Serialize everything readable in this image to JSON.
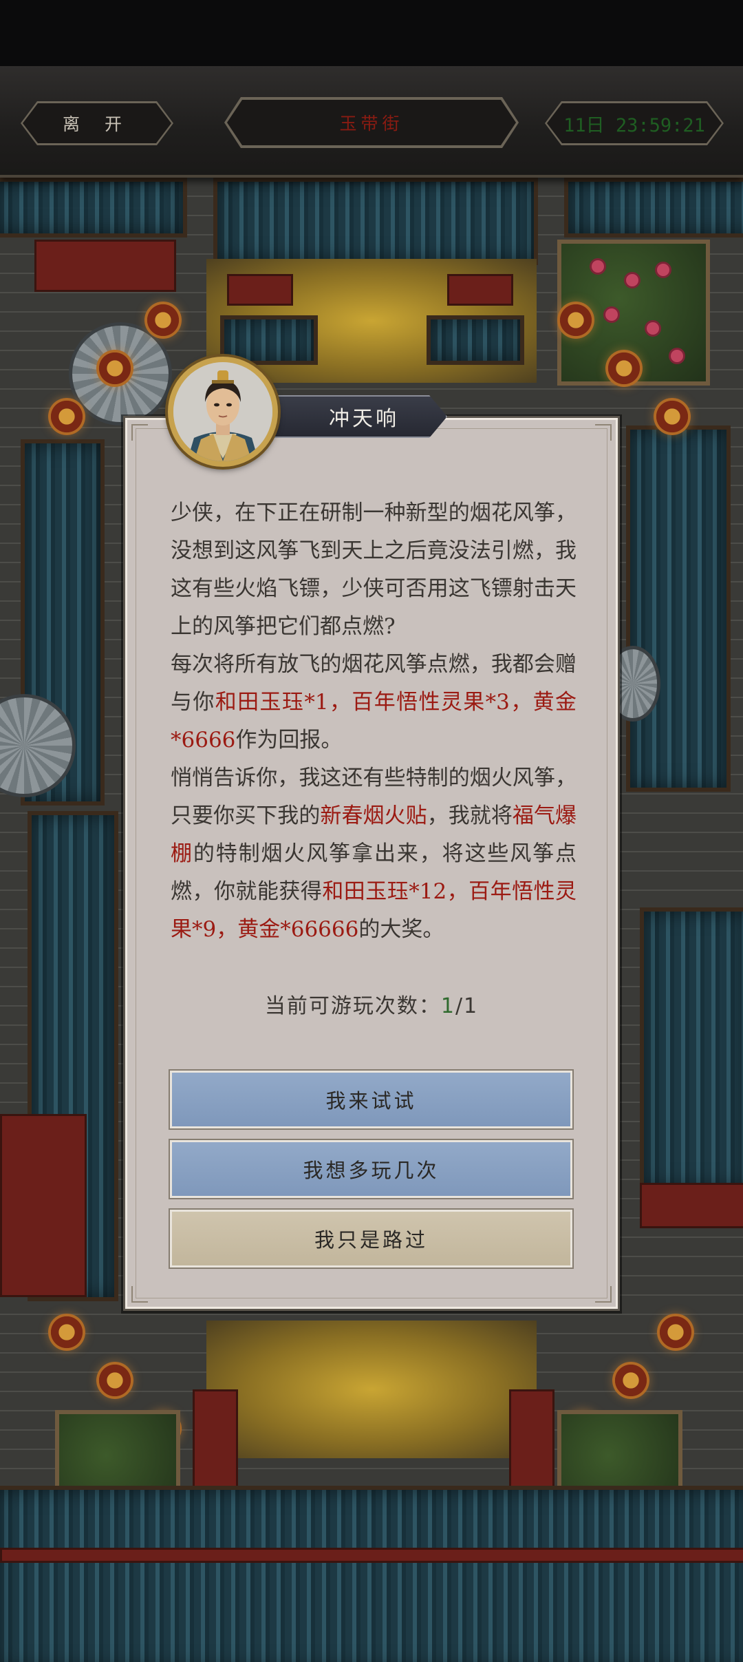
{
  "header": {
    "leave_label": "离 开",
    "street_title": "玉带街",
    "timer": "11日 23:59:21"
  },
  "dialog": {
    "npc_name": "冲天响",
    "avatar": "npc-portrait",
    "story": {
      "p1": "少侠，在下正在研制一种新型的烟花风筝，没想到这风筝飞到天上之后竟没法引燃，我这有些火焰飞镖，少侠可否用这飞镖射击天上的风筝把它们都点燃?",
      "p2_a": "每次将所有放飞的烟花风筝点燃，我都会赠与你",
      "p2_reward1": "和田玉珏*1",
      "p2_sep1": "，",
      "p2_reward2": "百年悟性灵果*3",
      "p2_sep2": "，",
      "p2_reward3": "黄金*6666",
      "p2_b": "作为回报。",
      "p3_a": "悄悄告诉你，我这还有些特制的烟火风筝，只要你买下我的",
      "p3_item": "新春烟火贴",
      "p3_b": "，我就将",
      "p3_item2": "福气爆棚",
      "p3_c": "的特制烟火风筝拿出来，将这些风筝点燃，你就能获得",
      "p3_reward1": "和田玉珏*12",
      "p3_sep1": "，",
      "p3_reward2": "百年悟性灵果*9",
      "p3_sep2": "，",
      "p3_reward3": "黄金*66666",
      "p3_d": "的大奖。"
    },
    "play_count_label": "当前可游玩次数：",
    "play_count_current": "1",
    "play_count_total": "/1",
    "buttons": {
      "try": "我来试试",
      "more": "我想多玩几次",
      "pass": "我只是路过"
    }
  },
  "colors": {
    "highlight": "#9b1a12",
    "count_current": "#2f6a2e",
    "button_blue": "#8aa2c3",
    "button_plain": "#c8bda4",
    "street_title": "#8a1b12",
    "timer": "#1f5e22"
  }
}
